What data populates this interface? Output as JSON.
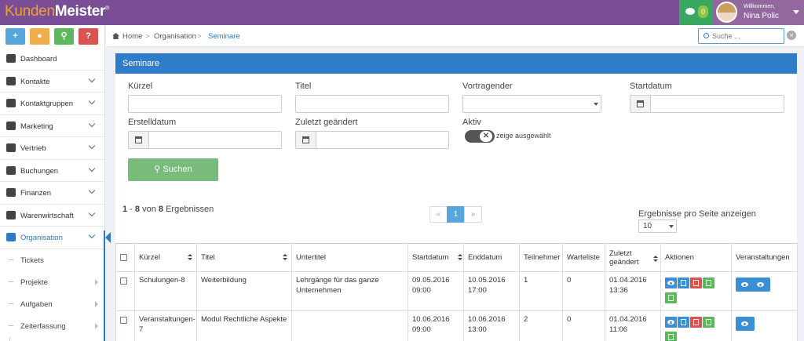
{
  "app": {
    "logo_first": "Kunden",
    "logo_second": "Meister",
    "logo_mark": "®"
  },
  "topbar": {
    "chat_count": "0",
    "welcome": "Willkommen,",
    "user_name": "Nina Polic"
  },
  "quick_buttons": [
    {
      "label": "+",
      "color": "#56a5dc",
      "icon": "plus-icon"
    },
    {
      "label": "●",
      "color": "#f0ad4e",
      "icon": "comment-icon"
    },
    {
      "label": "⚲",
      "color": "#5cb85c",
      "icon": "search-icon"
    },
    {
      "label": "?",
      "color": "#d9534f",
      "icon": "help-icon"
    }
  ],
  "sidebar": {
    "items": [
      {
        "label": "Dashboard",
        "icon": "dashboard-icon"
      },
      {
        "label": "Kontakte",
        "icon": "user-icon"
      },
      {
        "label": "Kontaktgruppen",
        "icon": "users-icon"
      },
      {
        "label": "Marketing",
        "icon": "envelope-icon"
      },
      {
        "label": "Vertrieb",
        "icon": "bar-chart-icon"
      },
      {
        "label": "Buchungen",
        "icon": "bookmark-icon"
      },
      {
        "label": "Finanzen",
        "icon": "money-icon"
      },
      {
        "label": "Warenwirtschaft",
        "icon": "globe-icon"
      },
      {
        "label": "Organisation",
        "icon": "edit-icon"
      }
    ],
    "sub_items": [
      {
        "label": "Tickets"
      },
      {
        "label": "Projekte"
      },
      {
        "label": "Aufgaben"
      },
      {
        "label": "Zeiterfassung"
      }
    ]
  },
  "breadcrumb": {
    "home": "Home",
    "sep": ">",
    "level1": "Organisation",
    "current": "Seminare"
  },
  "search": {
    "placeholder": "Suche ...",
    "clear": "×"
  },
  "panel": {
    "title": "Seminare"
  },
  "filters": {
    "kuerzel": "Kürzel",
    "titel": "Titel",
    "vortragender": "Vortragender",
    "startdatum": "Startdatum",
    "erstelldatum": "Erstelldatum",
    "zuletzt_geaendert": "Zuletzt geändert",
    "aktiv": "Aktiv",
    "toggle_text": "zeige ausgewählt",
    "search_button": "Suchen"
  },
  "results": {
    "from": "1",
    "to": "8",
    "total": "8",
    "text_von": "von",
    "text_ergebnis": "Ergebnissen"
  },
  "pager": {
    "prev": "«",
    "current": "1",
    "next": "»"
  },
  "per_page": {
    "label": "Ergebnisse pro Seite anzeigen",
    "value": "10"
  },
  "table": {
    "headers": [
      "",
      "Kürzel",
      "Titel",
      "Untertitel",
      "Startdatum",
      "Enddatum",
      "Teilnehmer",
      "Warteliste",
      "Zuletzt geändert",
      "Aktionen",
      "Veranstaltungen"
    ],
    "rows": [
      {
        "kuerzel": "Schulungen-8",
        "titel": "Weiterbildung",
        "untertitel": "Lehrgänge für das ganze Unternehmen",
        "start_date": "09.05.2016",
        "start_time": "09:00",
        "end_date": "10.05.2016",
        "end_time": "17:00",
        "teilnehmer": "1",
        "warteliste": "0",
        "changed_date": "01.04.2016",
        "changed_time": "13:36"
      },
      {
        "kuerzel": "Veranstaltungen-7",
        "titel": "Modul Rechtliche Aspekte",
        "untertitel": "",
        "start_date": "10.06.2016",
        "start_time": "09:00",
        "end_date": "10.06.2016",
        "end_time": "13:00",
        "teilnehmer": "2",
        "warteliste": "0",
        "changed_date": "01.04.2016",
        "changed_time": "11:06"
      }
    ]
  },
  "colors": {
    "topbar": "#7a4e97",
    "accent": "#2f7cc8",
    "success": "#78bb7b",
    "danger": "#d9534f"
  }
}
